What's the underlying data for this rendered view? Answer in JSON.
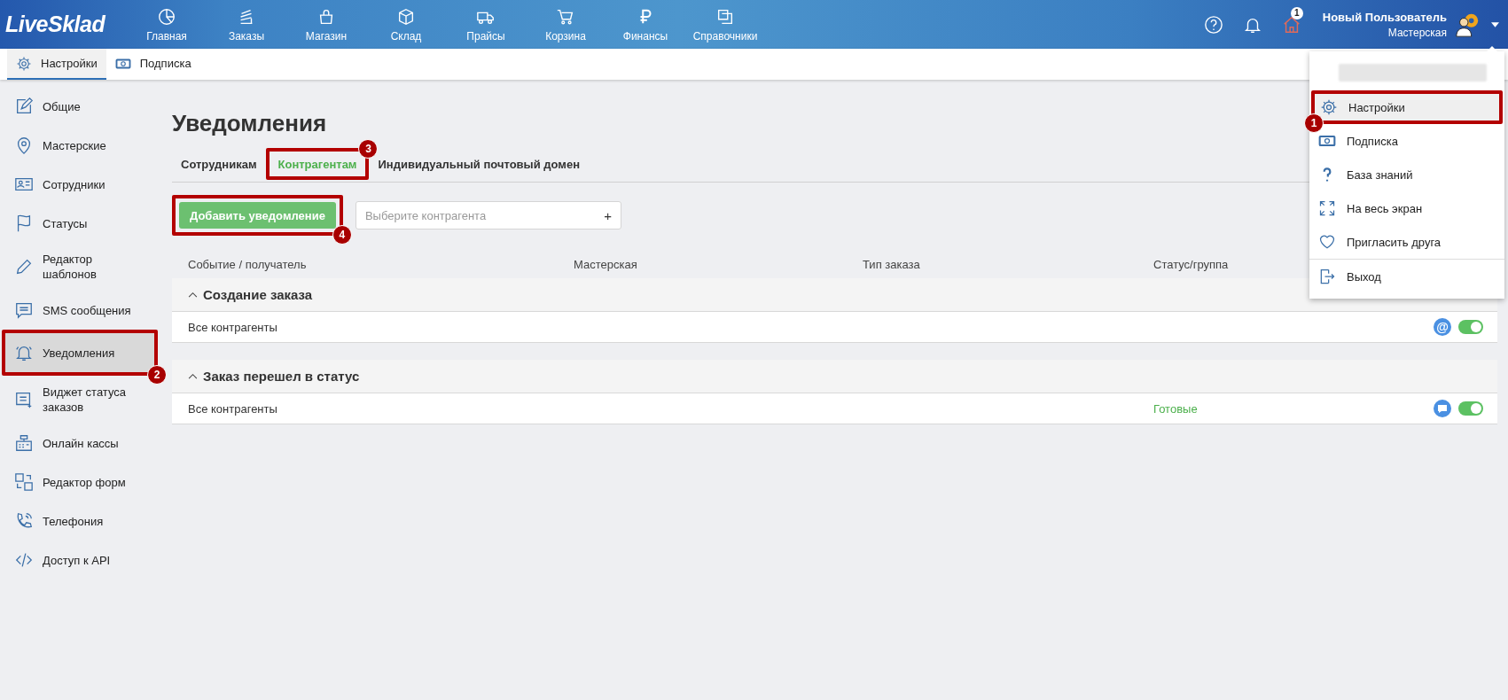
{
  "app_bar": {
    "logo": "LiveSklad",
    "nav": [
      {
        "label": "Главная"
      },
      {
        "label": "Заказы"
      },
      {
        "label": "Магазин"
      },
      {
        "label": "Склад"
      },
      {
        "label": "Прайсы"
      },
      {
        "label": "Корзина"
      },
      {
        "label": "Финансы"
      },
      {
        "label": "Справочники"
      }
    ],
    "home_badge": "1",
    "user": {
      "name": "Новый Пользователь",
      "role": "Мастерская"
    }
  },
  "subtabs": [
    {
      "label": "Настройки",
      "selected": true
    },
    {
      "label": "Подписка",
      "selected": false
    }
  ],
  "sidebar": {
    "items": [
      {
        "label": "Общие",
        "selected": false
      },
      {
        "label": "Мастерские",
        "selected": false
      },
      {
        "label": "Сотрудники",
        "selected": false
      },
      {
        "label": "Статусы",
        "selected": false
      },
      {
        "label": "Редактор шаблонов",
        "selected": false
      },
      {
        "label": "SMS сообщения",
        "selected": false
      },
      {
        "label": "Уведомления",
        "selected": true,
        "callout": "2"
      },
      {
        "label": "Виджет статуса заказов",
        "selected": false
      },
      {
        "label": "Онлайн кассы",
        "selected": false
      },
      {
        "label": "Редактор форм",
        "selected": false
      },
      {
        "label": "Телефония",
        "selected": false
      },
      {
        "label": "Доступ к API",
        "selected": false
      }
    ]
  },
  "page": {
    "title": "Уведомления",
    "tabs": [
      {
        "label": "Сотрудникам",
        "selected": false
      },
      {
        "label": "Контрагентам",
        "selected": true,
        "callout": "3"
      },
      {
        "label": "Индивидуальный почтовый домен",
        "selected": false
      }
    ],
    "add_button": {
      "label": "Добавить уведомление",
      "callout": "4"
    },
    "contractor_select": {
      "placeholder": "Выберите контрагента",
      "add_glyph": "+"
    },
    "table": {
      "columns": [
        "Событие / получатель",
        "Мастерская",
        "Тип заказа",
        "Статус/группа"
      ],
      "groups": [
        {
          "title": "Создание заказа",
          "expanded": true,
          "rows": [
            {
              "recipient": "Все контрагенты",
              "channel": {
                "kind": "email",
                "glyph": "@"
              },
              "on": true
            }
          ]
        },
        {
          "title": "Заказ перешел в статус",
          "expanded": true,
          "rows": [
            {
              "recipient": "Все контрагенты",
              "status": "Готовые",
              "channel": {
                "kind": "chat"
              },
              "on": true
            }
          ]
        }
      ]
    }
  },
  "user_menu": {
    "items": [
      {
        "label": "Настройки",
        "selected": true,
        "callout": "1"
      },
      {
        "label": "Подписка",
        "selected": false
      },
      {
        "label": "База знаний",
        "selected": false
      },
      {
        "label": "На весь экран",
        "selected": false
      },
      {
        "label": "Пригласить друга",
        "selected": false
      },
      {
        "label": "Выход",
        "selected": false
      }
    ]
  }
}
